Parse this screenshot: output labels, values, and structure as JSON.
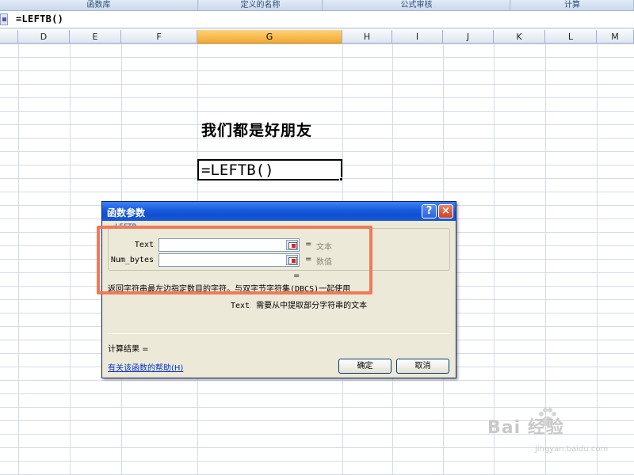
{
  "ribbon": {
    "groups": [
      "函数库",
      "定义的名称",
      "公式审核",
      "计算"
    ]
  },
  "formula_bar": {
    "content": "=LEFTB()"
  },
  "columns": [
    "D",
    "E",
    "F",
    "G",
    "H",
    "I",
    "J",
    "K",
    "L",
    "M"
  ],
  "selected_column": "G",
  "cells": {
    "g_text": "我们都是好朋友",
    "active_cell": "=LEFTB()"
  },
  "dialog": {
    "title": "函数参数",
    "help_button": "?",
    "close_button": "×",
    "function_name": "LEFTB",
    "params": [
      {
        "name": "Text",
        "value": "",
        "eq": "=",
        "hint": "文本"
      },
      {
        "name": "Num_bytes",
        "value": "",
        "eq": "=",
        "hint": "数值"
      }
    ],
    "result_eq": "=",
    "description": "返回字符串最左边指定数目的字符。与双字节字符集(DBCS)一起使用",
    "param_desc_name": "Text",
    "param_desc_text": "需要从中提取部分字符串的文本",
    "calc_result": "计算结果 =",
    "help_link": "有关该函数的帮助(H)",
    "ok": "确定",
    "cancel": "取消"
  },
  "watermark": {
    "brand": "Bai 经验",
    "url": "jingyan.baidu.com"
  },
  "colors": {
    "highlight": "#f07a57",
    "titlebar": "#1a5ee0",
    "selected_column": "#f3a82f"
  }
}
